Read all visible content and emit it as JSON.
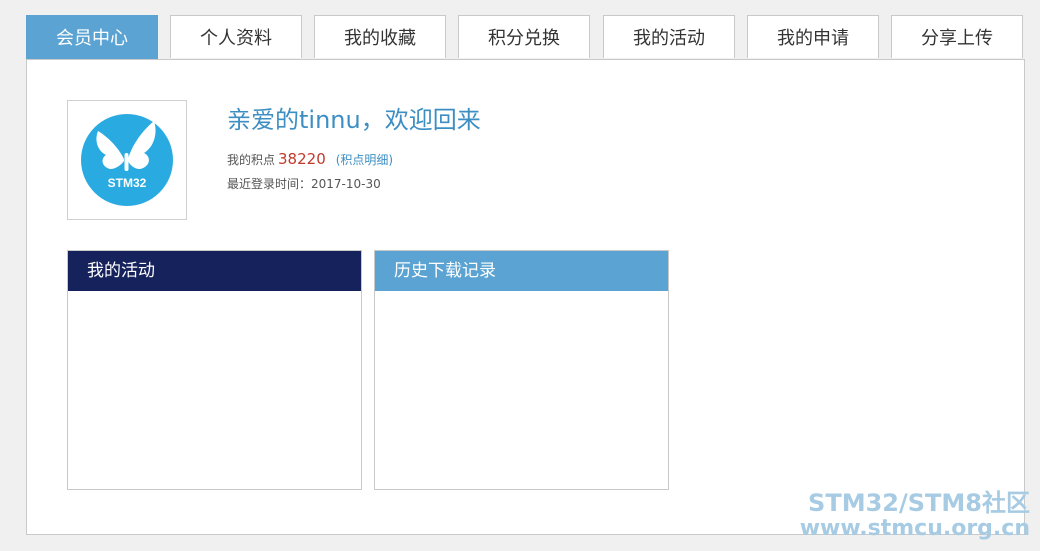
{
  "tabs": [
    {
      "label": "会员中心",
      "active": true
    },
    {
      "label": "个人资料",
      "active": false
    },
    {
      "label": "我的收藏",
      "active": false
    },
    {
      "label": "积分兑换",
      "active": false
    },
    {
      "label": "我的活动",
      "active": false
    },
    {
      "label": "我的申请",
      "active": false
    },
    {
      "label": "分享上传",
      "active": false
    }
  ],
  "profile": {
    "avatar_logo_text": "STM32",
    "welcome": "亲爱的tinnu，欢迎回来",
    "points_label": "我的积点",
    "points_value": "38220",
    "points_detail_link": "(积点明细)",
    "last_login_label": "最近登录时间：",
    "last_login_value": "2017-10-30"
  },
  "boxes": {
    "activity_title": "我的活动",
    "history_title": "历史下载记录"
  },
  "watermark": {
    "line1": "STM32/STM8社区",
    "line2": "www.stmcu.org.cn"
  },
  "colors": {
    "active_tab": "#5aa3d2",
    "activity_header": "#15225c",
    "history_header": "#5aa3d2",
    "welcome_text": "#3d8fc3",
    "points_value": "#c0392b",
    "logo_circle": "#29abe2"
  }
}
